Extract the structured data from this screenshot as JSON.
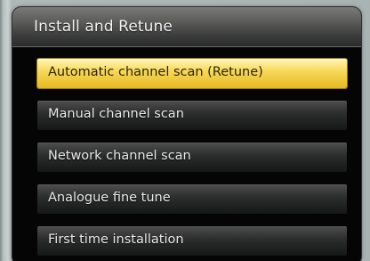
{
  "screen": {
    "title": "Install and Retune"
  },
  "menu": {
    "selected_index": 0,
    "items": [
      {
        "label": "Automatic channel scan (Retune)"
      },
      {
        "label": "Manual channel scan"
      },
      {
        "label": "Network channel scan"
      },
      {
        "label": "Analogue fine tune"
      },
      {
        "label": "First time installation"
      }
    ]
  }
}
